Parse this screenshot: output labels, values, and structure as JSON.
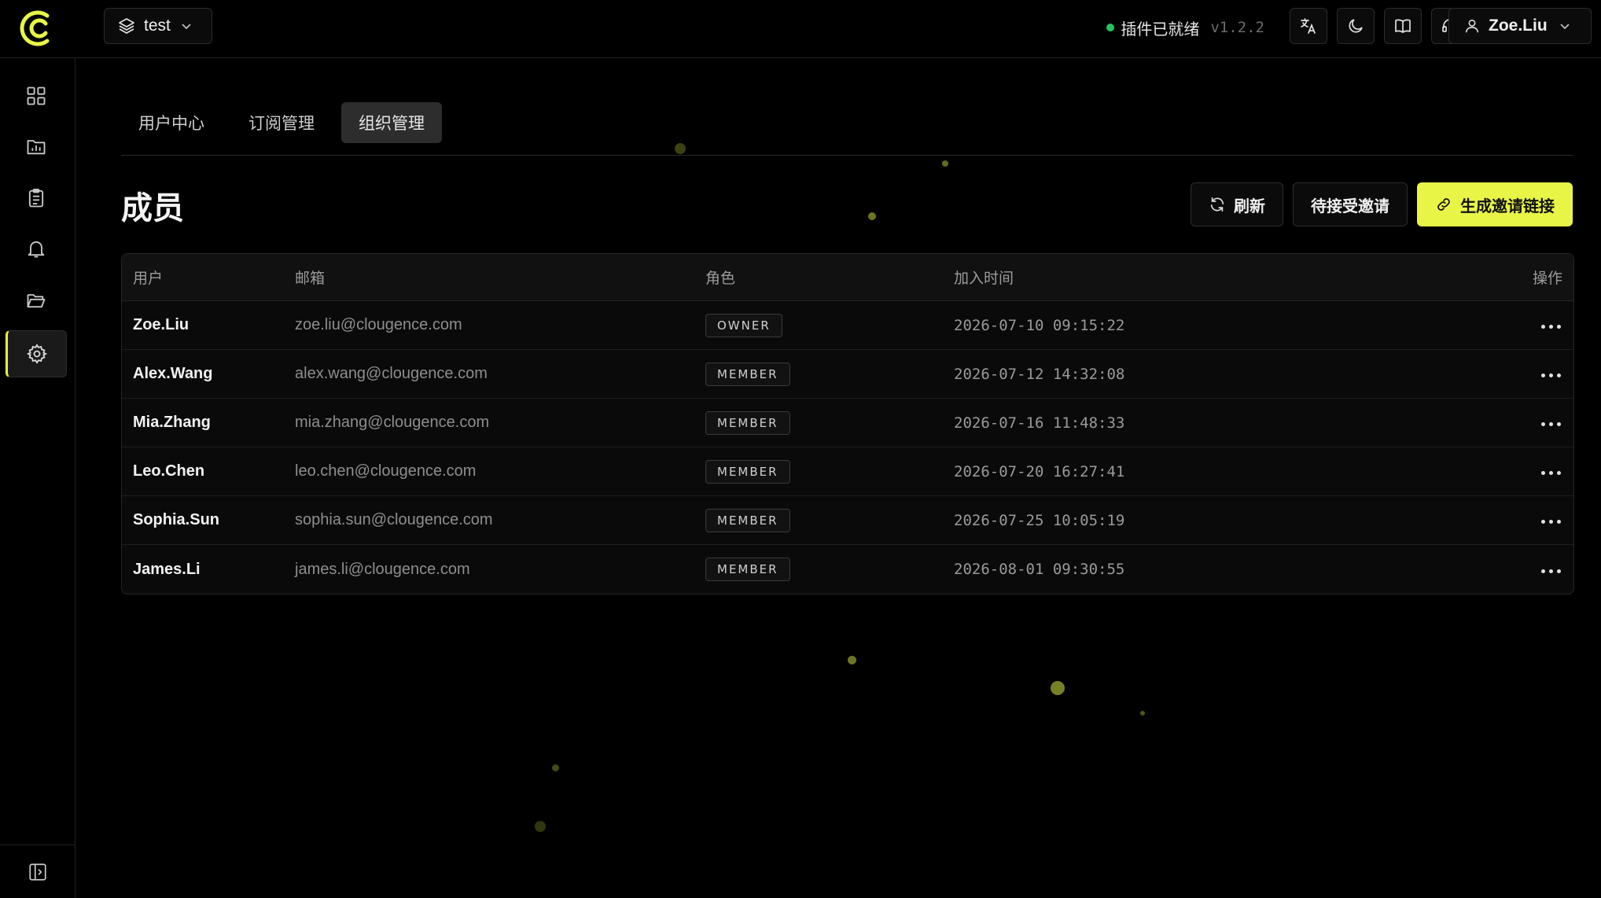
{
  "colors": {
    "accent": "#e8f547",
    "status_ok": "#22c55e",
    "background": "#000000"
  },
  "header": {
    "workspace": "test",
    "status_text": "插件已就绪",
    "version": "v1.2.2",
    "icons": [
      "translate-icon",
      "moon-icon",
      "book-icon",
      "headset-icon"
    ],
    "user": "Zoe.Liu"
  },
  "sidebar": {
    "items": [
      {
        "icon": "grid-icon",
        "active": false
      },
      {
        "icon": "chart-folder-icon",
        "active": false
      },
      {
        "icon": "clipboard-icon",
        "active": false
      },
      {
        "icon": "bell-icon",
        "active": false
      },
      {
        "icon": "folder-open-icon",
        "active": false
      },
      {
        "icon": "gear-icon",
        "active": true
      }
    ]
  },
  "tabs": [
    {
      "label": "用户中心",
      "active": false
    },
    {
      "label": "订阅管理",
      "active": false
    },
    {
      "label": "组织管理",
      "active": true
    }
  ],
  "page": {
    "title": "成员",
    "buttons": {
      "refresh": "刷新",
      "pending": "待接受邀请",
      "invite": "生成邀请链接"
    }
  },
  "table": {
    "columns": [
      "用户",
      "邮箱",
      "角色",
      "加入时间",
      "操作"
    ],
    "rows": [
      {
        "user": "Zoe.Liu",
        "email": "zoe.liu@clougence.com",
        "role": "OWNER",
        "joined": "2026-07-10 09:15:22"
      },
      {
        "user": "Alex.Wang",
        "email": "alex.wang@clougence.com",
        "role": "MEMBER",
        "joined": "2026-07-12 14:32:08"
      },
      {
        "user": "Mia.Zhang",
        "email": "mia.zhang@clougence.com",
        "role": "MEMBER",
        "joined": "2026-07-16 11:48:33"
      },
      {
        "user": "Leo.Chen",
        "email": "leo.chen@clougence.com",
        "role": "MEMBER",
        "joined": "2026-07-20 16:27:41"
      },
      {
        "user": "Sophia.Sun",
        "email": "sophia.sun@clougence.com",
        "role": "MEMBER",
        "joined": "2026-07-25 10:05:19"
      },
      {
        "user": "James.Li",
        "email": "james.li@clougence.com",
        "role": "MEMBER",
        "joined": "2026-08-01 09:30:55"
      }
    ]
  }
}
